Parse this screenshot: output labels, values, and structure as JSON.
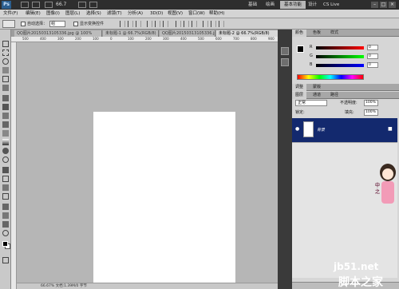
{
  "appbar": {
    "logo": "Ps",
    "zoom": "66.7",
    "workspaces": [
      "基础",
      "绘画",
      "基本功能",
      "设计"
    ],
    "active_workspace": "基本功能",
    "cs_live": "CS Live",
    "window_buttons": [
      "–",
      "□",
      "×"
    ]
  },
  "menu": [
    "文件(F)",
    "编辑(E)",
    "图像(I)",
    "图层(L)",
    "选择(S)",
    "滤镜(T)",
    "分析(A)",
    "3D(D)",
    "视图(V)",
    "窗口(W)",
    "帮助(H)"
  ],
  "options": {
    "auto_select": "自动选择：",
    "auto_select_value": "组",
    "show_transform": "显示变换控件"
  },
  "tabs": [
    "QQ图片20150313105336.jpg @ 100%",
    "未标题-1 @ 66.7%(RGB/8)",
    "QQ图片20150313105336.jpg @ 100%",
    "未标题-2 @ 66.7%(RGB/8)"
  ],
  "ruler": [
    "500",
    "400",
    "300",
    "200",
    "100",
    "0",
    "100",
    "200",
    "300",
    "400",
    "500",
    "600",
    "700",
    "800",
    "900"
  ],
  "statusbar": "66.67%   文档:1.39M/0 字节",
  "colorpanel": {
    "tabs": [
      "颜色",
      "色板",
      "样式"
    ],
    "channels": [
      {
        "label": "R",
        "value": "0"
      },
      {
        "label": "G",
        "value": "0"
      },
      {
        "label": "B",
        "value": "0"
      }
    ]
  },
  "adjustments": {
    "tabs": [
      "调整",
      "蒙版"
    ]
  },
  "layerspanel": {
    "tabs": [
      "图层",
      "通道",
      "路径"
    ],
    "blend_mode": "正常",
    "opacity_label": "不透明度:",
    "opacity_value": "100%",
    "lock_label": "锁定:",
    "fill_label": "填充:",
    "fill_value": "100%",
    "layer_name": "背景"
  },
  "mascot_text": "中之",
  "watermark": {
    "url": "jb51.net",
    "name": "脚本之家"
  },
  "colors": {
    "ui_dark": "#2e2e2e",
    "panel": "#d6d6d6",
    "canvas_bg": "#b6b6b6",
    "layer_selected": "#13296e"
  }
}
